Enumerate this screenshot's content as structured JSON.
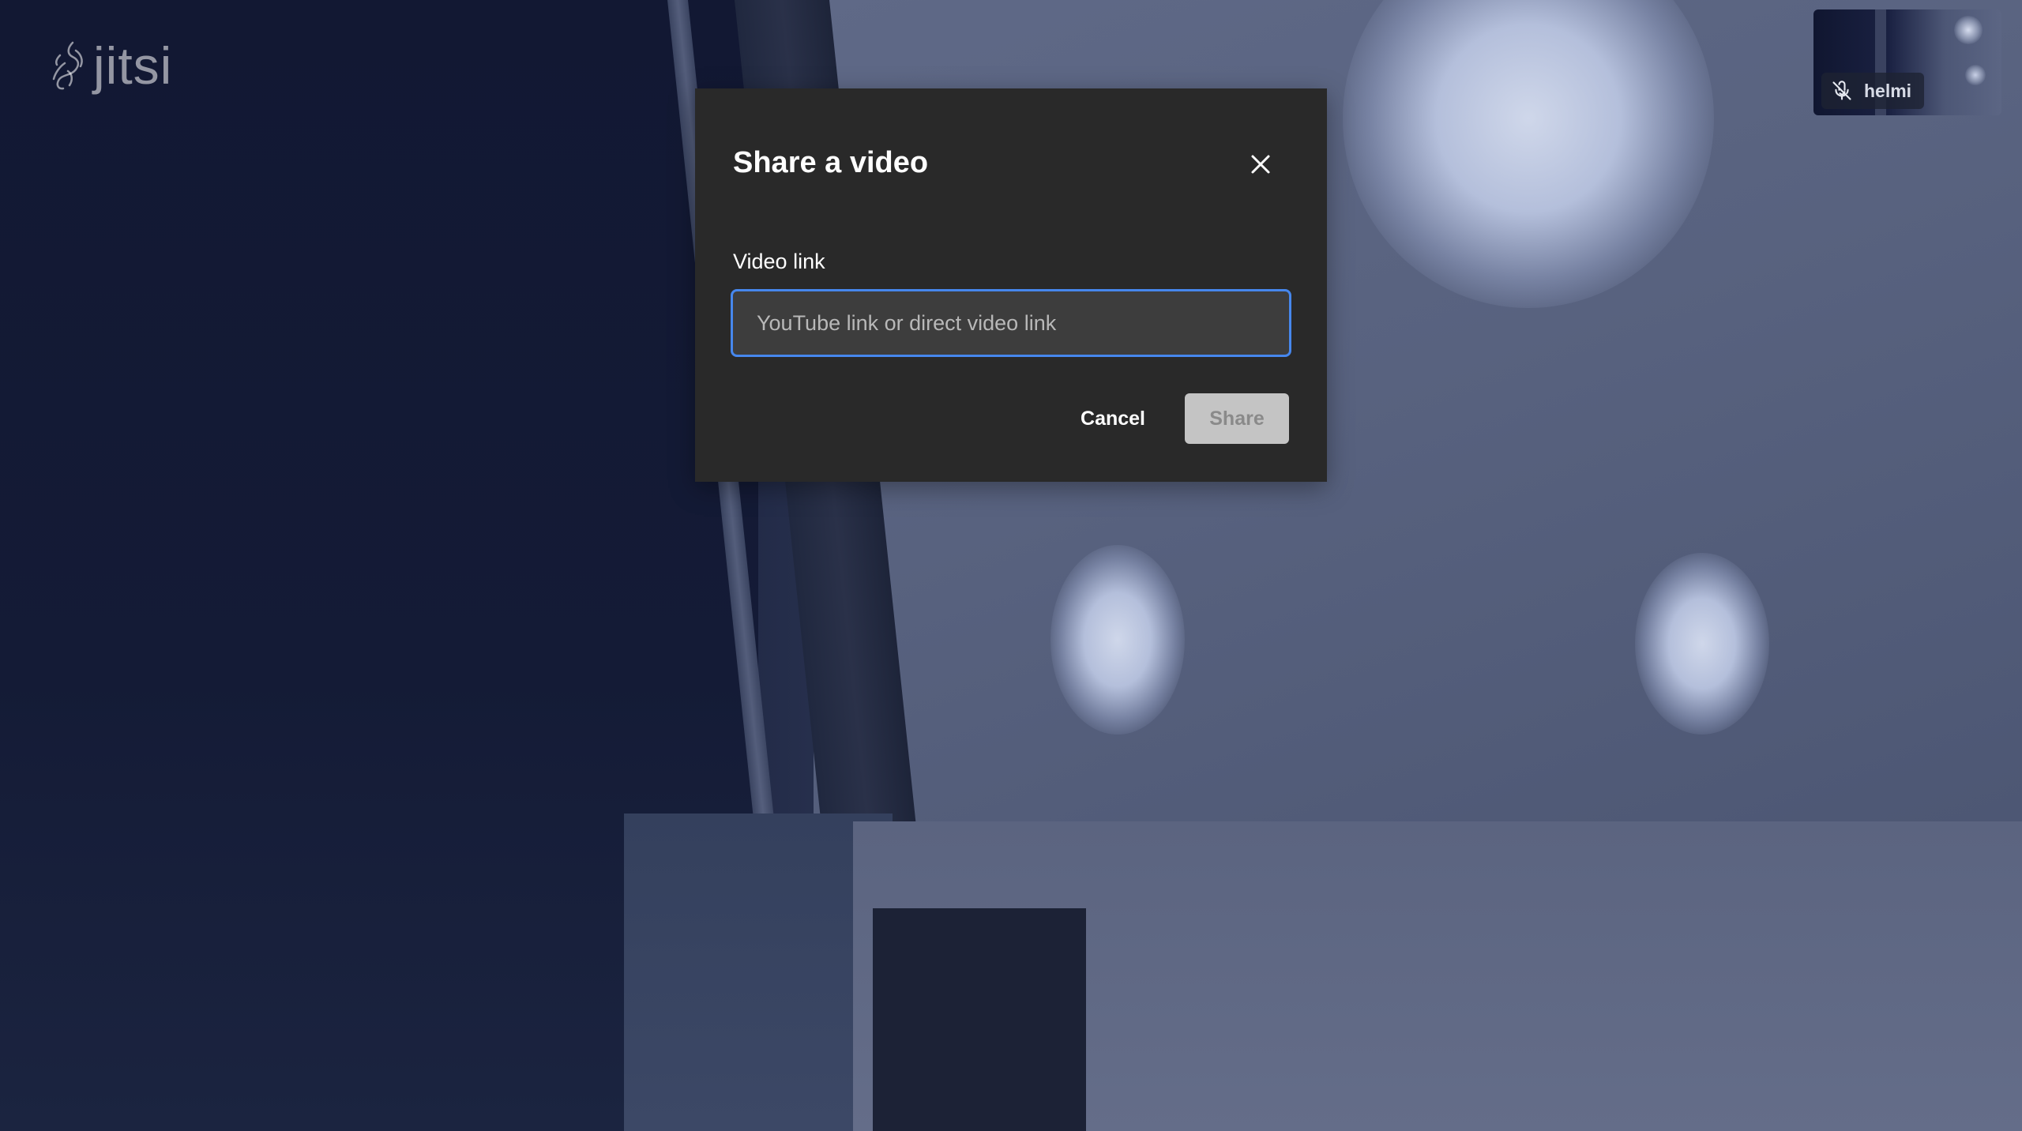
{
  "app": {
    "logo_text": "jitsi"
  },
  "self_view": {
    "participant_name": "helmi",
    "mic_icon": "mic-muted-icon"
  },
  "dialog": {
    "title": "Share a video",
    "close_icon": "close-icon",
    "field_label": "Video link",
    "input": {
      "value": "",
      "placeholder": "YouTube link or direct video link"
    },
    "cancel_label": "Cancel",
    "share_label": "Share",
    "share_enabled": false
  },
  "colors": {
    "dialog_bg": "#292929",
    "input_focus_border": "#4687ed",
    "share_disabled_bg": "#c4c4c4"
  }
}
